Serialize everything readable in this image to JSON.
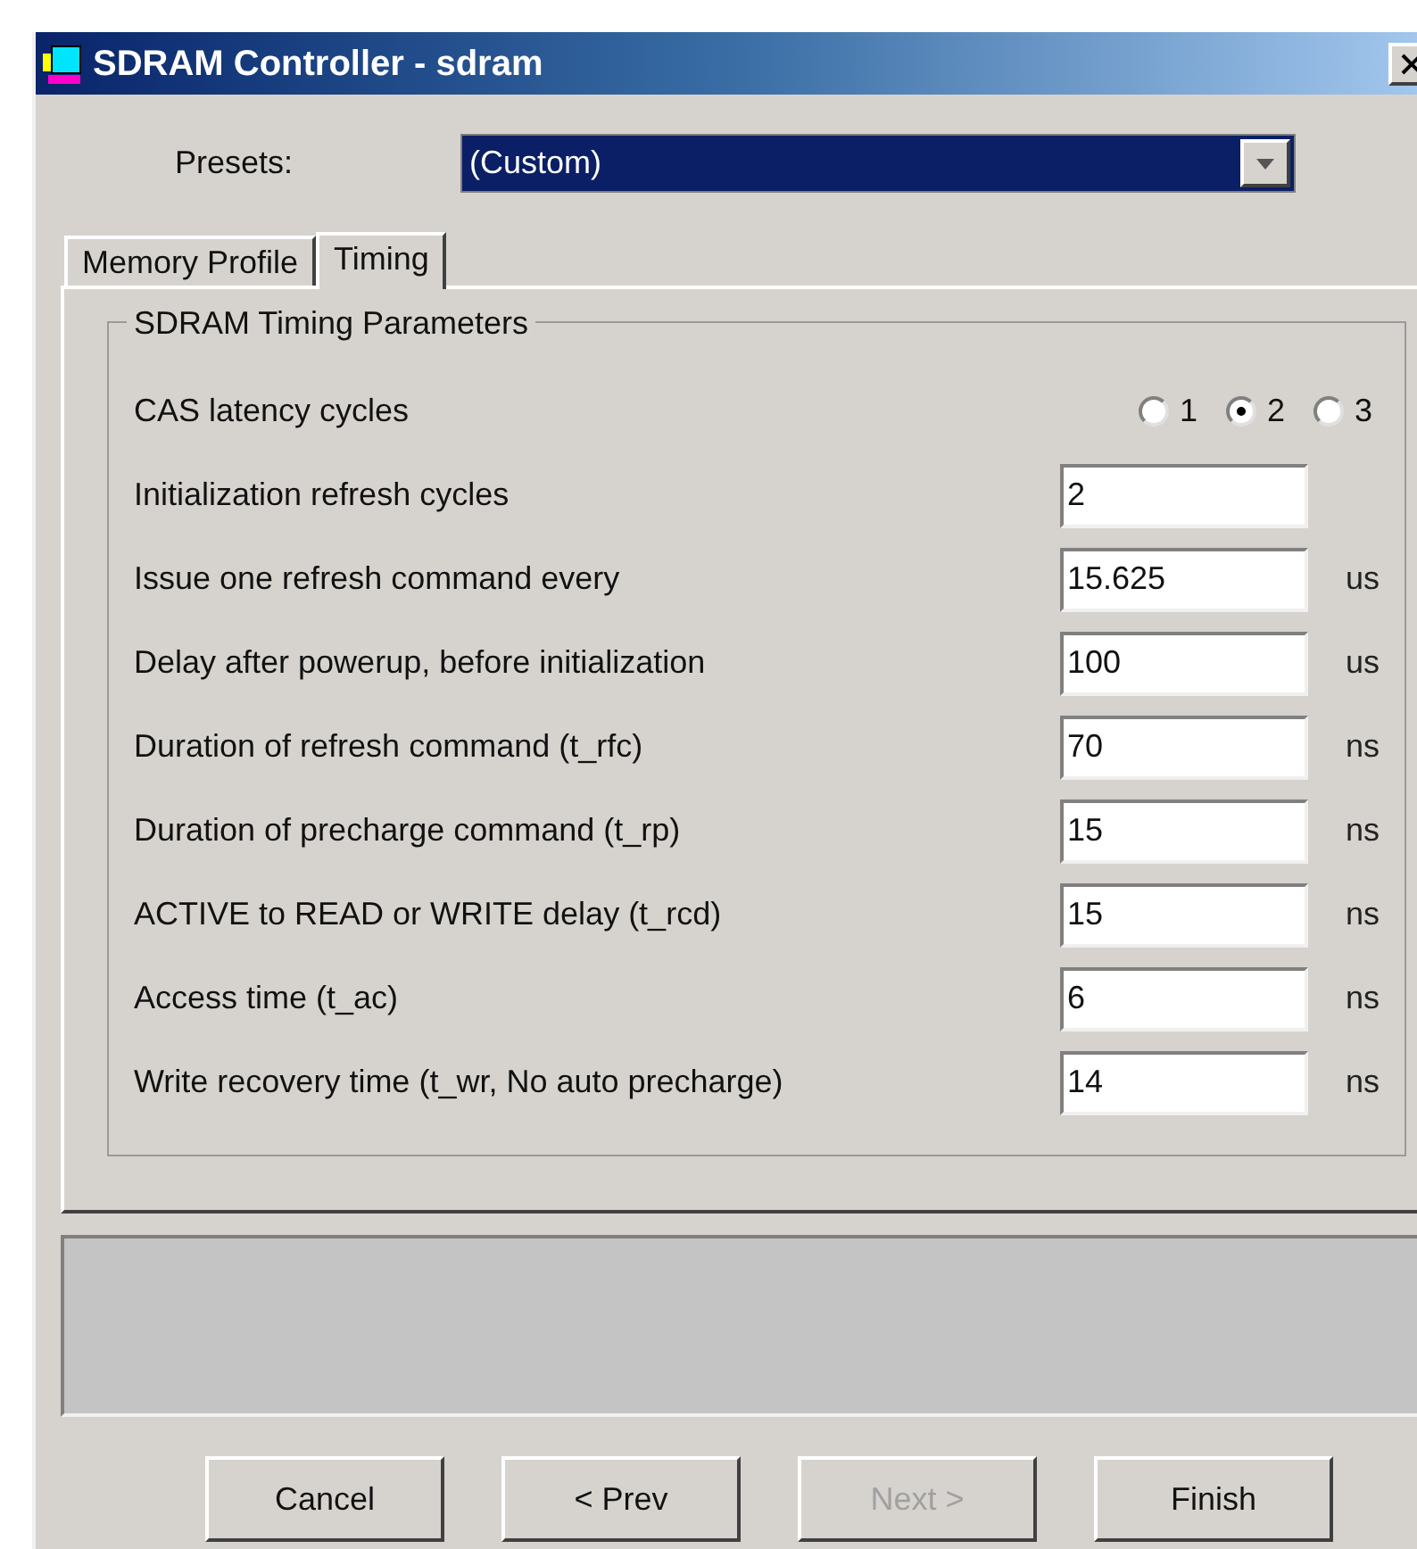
{
  "window": {
    "title": "SDRAM Controller - sdram"
  },
  "presets": {
    "label": "Presets:",
    "value": "(Custom)"
  },
  "tabs": [
    {
      "label": "Memory Profile",
      "selected": false
    },
    {
      "label": "Timing",
      "selected": true
    }
  ],
  "group": {
    "title": "SDRAM Timing Parameters"
  },
  "rows": [
    {
      "kind": "radio",
      "label": "CAS latency cycles",
      "options": [
        {
          "label": "1",
          "selected": false
        },
        {
          "label": "2",
          "selected": true
        },
        {
          "label": "3",
          "selected": false
        }
      ]
    },
    {
      "kind": "field",
      "label": "Initialization refresh cycles",
      "value": "2"
    },
    {
      "kind": "field",
      "label": "Issue one refresh command every",
      "value": "15.625",
      "unit": "us"
    },
    {
      "kind": "field",
      "label": "Delay after powerup, before initialization",
      "value": "100",
      "unit": "us"
    },
    {
      "kind": "field",
      "label": "Duration of refresh command (t_rfc)",
      "value": "70",
      "unit": "ns"
    },
    {
      "kind": "field",
      "label": "Duration of precharge command (t_rp)",
      "value": "15",
      "unit": "ns"
    },
    {
      "kind": "field",
      "label": "ACTIVE to READ or WRITE delay (t_rcd)",
      "value": "15",
      "unit": "ns"
    },
    {
      "kind": "field",
      "label": "Access time (t_ac)",
      "value": "6",
      "unit": "ns"
    },
    {
      "kind": "field",
      "label": "Write recovery time (t_wr, No auto precharge)",
      "value": "14",
      "unit": "ns"
    }
  ],
  "buttons": [
    {
      "label": "Cancel",
      "disabled": false
    },
    {
      "label": "< Prev",
      "disabled": false
    },
    {
      "label": "Next >",
      "disabled": true
    },
    {
      "label": "Finish",
      "disabled": false
    }
  ]
}
